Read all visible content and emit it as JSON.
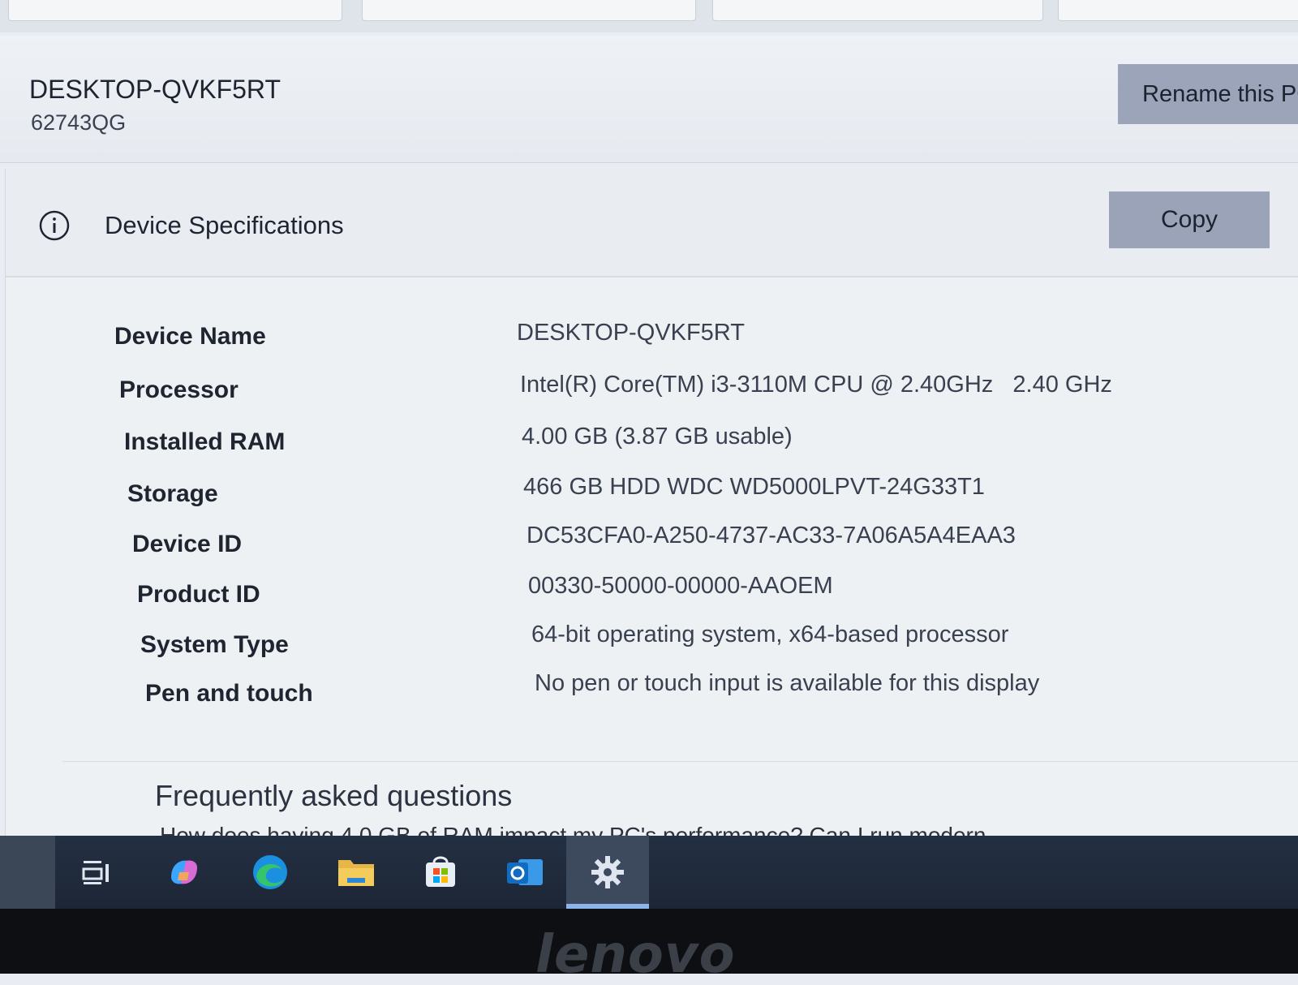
{
  "header": {
    "pc_name": "DESKTOP-QVKF5RT",
    "pc_model": "62743QG",
    "rename_button": "Rename this PC"
  },
  "specs": {
    "title": "Device Specifications",
    "copy_button": "Copy",
    "rows": [
      {
        "label": "Device Name",
        "value": "DESKTOP-QVKF5RT"
      },
      {
        "label": "Processor",
        "value": "Intel(R) Core(TM) i3-3110M CPU @ 2.40GHz   2.40 GHz"
      },
      {
        "label": "Installed RAM",
        "value": "4.00 GB (3.87 GB usable)"
      },
      {
        "label": "Storage",
        "value": "466 GB HDD WDC WD5000LPVT-24G33T1"
      },
      {
        "label": "Device ID",
        "value": "DC53CFA0-A250-4737-AC33-7A06A5A4EAA3"
      },
      {
        "label": "Product ID",
        "value": "00330-50000-00000-AAOEM"
      },
      {
        "label": "System Type",
        "value": "64-bit operating system, x64-based processor"
      },
      {
        "label": "Pen and touch",
        "value": "No pen or touch input is available for this display"
      }
    ]
  },
  "faq": {
    "title": "Frequently asked questions",
    "first_question": "How does having 4.0 GB of RAM impact my PC's performance? Can I run modern"
  },
  "taskbar": {
    "items": [
      "task-view-icon",
      "copilot-icon",
      "edge-icon",
      "file-explorer-icon",
      "microsoft-store-icon",
      "outlook-icon",
      "settings-icon"
    ]
  },
  "bezel": {
    "brand": "lenovo"
  }
}
